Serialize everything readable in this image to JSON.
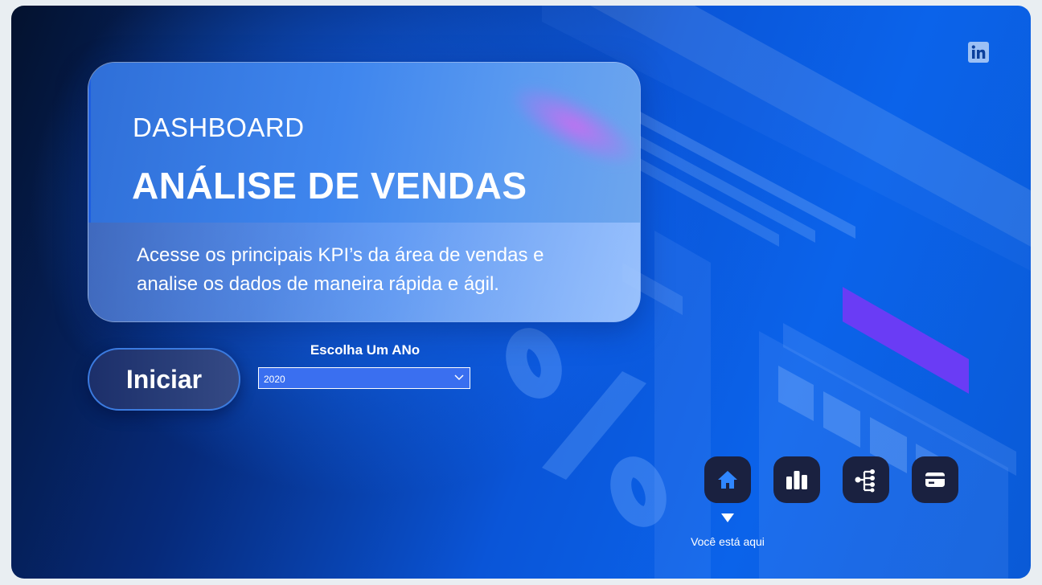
{
  "hero": {
    "eyebrow": "DASHBOARD",
    "title": "ANÁLISE DE VENDAS",
    "description": "Acesse os principais KPI’s da área de vendas e analise os dados de maneira rápida e ágil."
  },
  "actions": {
    "start_label": "Iniciar"
  },
  "year_filter": {
    "label": "Escolha Um ANo",
    "selected": "2020"
  },
  "social": {
    "linkedin_icon": "linkedin-icon"
  },
  "nav": {
    "items": [
      {
        "icon": "home-icon",
        "active": true
      },
      {
        "icon": "bar-chart-icon",
        "active": false
      },
      {
        "icon": "hierarchy-icon",
        "active": false
      },
      {
        "icon": "credit-card-icon",
        "active": false
      }
    ],
    "current_page_label": "Você está aqui"
  },
  "colors": {
    "background_dark": "#04122e",
    "background_blue": "#0a5ad6",
    "nav_button": "#1a2140",
    "active_icon": "#2f86ff",
    "accent_purple": "#6a3cf5"
  }
}
